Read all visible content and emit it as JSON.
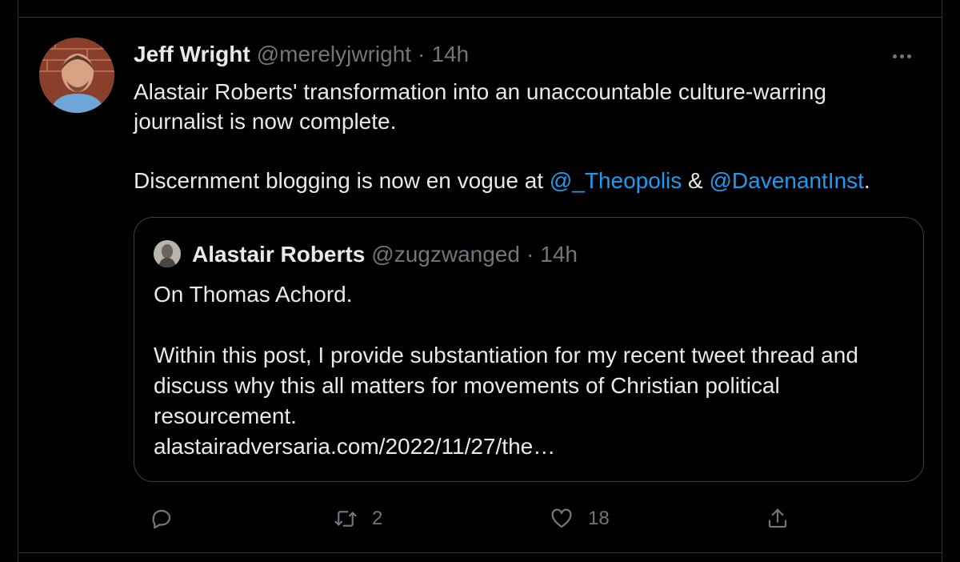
{
  "tweet": {
    "author_name": "Jeff Wright",
    "author_handle": "@merelyjwright",
    "separator": "·",
    "time": "14h",
    "text_line1_prefix": "Alastair Roberts' transformation into an unaccountable culture-warring journalist is now complete.",
    "text_line2_prefix": "Discernment blogging is now en vogue at ",
    "mention1": "@_Theopolis",
    "amp": " & ",
    "mention2": "@DavenantInst",
    "period": "."
  },
  "quote": {
    "author_name": "Alastair Roberts",
    "author_handle": "@zugzwanged",
    "separator": "·",
    "time": "14h",
    "para1": "On Thomas Achord.",
    "para2": "Within this post, I provide substantiation for my recent tweet thread and discuss why this all matters for movements of Christian political resourcement.",
    "link": "alastairadversaria.com/2022/11/27/the…"
  },
  "actions": {
    "reply_count": "",
    "retweet_count": "2",
    "like_count": "18"
  },
  "colors": {
    "background": "#000000",
    "text": "#e7e9ea",
    "secondary": "#71767b",
    "link": "#1d9bf0",
    "border": "#2f3336"
  },
  "icons": [
    "more-icon",
    "reply-icon",
    "retweet-icon",
    "like-icon",
    "share-icon"
  ]
}
